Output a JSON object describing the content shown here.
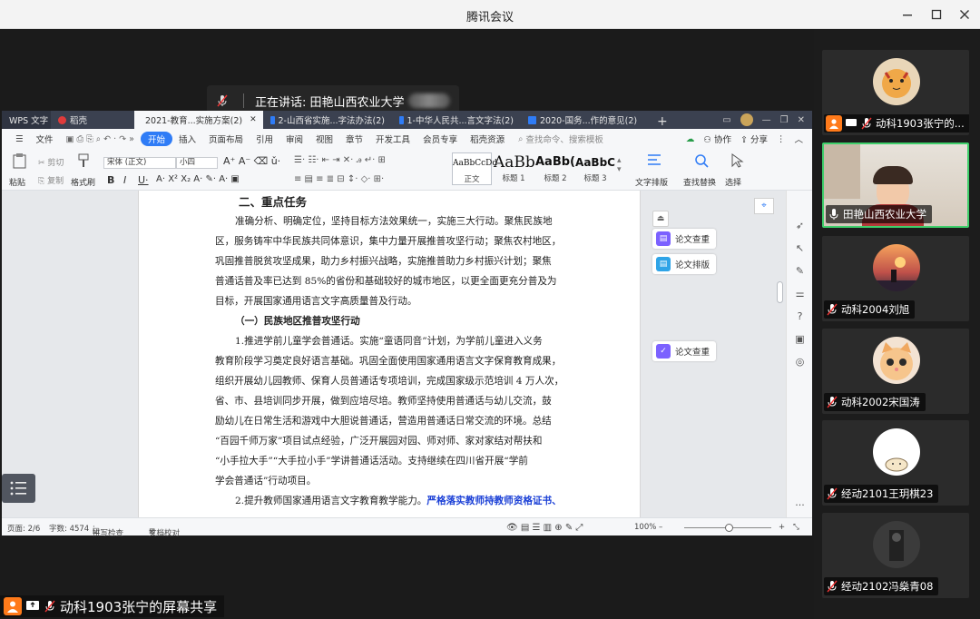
{
  "window": {
    "title": "腾讯会议"
  },
  "speaking": {
    "label": "正在讲话: 田艳山西农业大学"
  },
  "share_label": "动科1903张宁的屏幕共享",
  "wps": {
    "tabs": [
      {
        "label": "WPS 文字",
        "color": "#3b4150"
      },
      {
        "label": "稻壳",
        "color": "#e03b3b"
      },
      {
        "label": "2021-教育...实施方案(2)",
        "color": "#2f7cf6"
      },
      {
        "label": "2-山西省实施...字法办法(2)",
        "color": "#2f7cf6"
      },
      {
        "label": "1-中华人民共...言文字法(2)",
        "color": "#2f7cf6"
      },
      {
        "label": "2020-国务...作的意见(2)",
        "color": "#2f7cf6"
      }
    ],
    "menu": {
      "file": "文件",
      "items": [
        "开始",
        "插入",
        "页面布局",
        "引用",
        "审阅",
        "视图",
        "章节",
        "开发工具",
        "会员专享",
        "稻壳资源"
      ],
      "search": "查找命令、搜索模板",
      "collab": "协作",
      "share": "分享"
    },
    "ribbon": {
      "paste": "粘贴",
      "cut": "剪切",
      "copy": "复制",
      "format_painter": "格式刷",
      "font_name": "宋体 (正文)",
      "font_size": "小四",
      "styles": [
        {
          "sample": "AaBbCcDd",
          "label": "正文"
        },
        {
          "sample": "AaBb",
          "label": "标题 1"
        },
        {
          "sample": "AaBb(",
          "label": "标题 2"
        },
        {
          "sample": "AaBbC",
          "label": "标题 3"
        }
      ],
      "text_layout": "文字排版",
      "find_replace": "查找替换",
      "select": "选择"
    },
    "doc": {
      "lines": [
        "二、重点任务",
        "准确分析、明确定位，坚持目标方法效果统一，实施三大行动。聚焦民族地",
        "区，服务铸牢中华民族共同体意识，集中力量开展推普攻坚行动；聚焦农村地区，",
        "巩固推普脱贫攻坚成果，助力乡村振兴战略，实施推普助力乡村振兴计划；聚焦",
        "普通话普及率已达到 85%的省份和基础较好的城市地区，以更全面更充分普及为",
        "目标，开展国家通用语言文字高质量普及行动。",
        "（一）民族地区推普攻坚行动",
        "1.推进学前儿童学会普通话。实施“童语同音”计划，为学前儿童进入义务",
        "教育阶段学习奠定良好语言基础。巩固全面使用国家通用语言文字保育教育成果，",
        "组织开展幼儿园教师、保育人员普通话专项培训，完成国家级示范培训 4 万人次，",
        "省、市、县培训同步开展，做到应培尽培。教师坚持使用普通话与幼儿交流，鼓",
        "励幼儿在日常生活和游戏中大胆说普通话，营造用普通话日常交流的环境。总结",
        "“百园千师万家”项目试点经验，广泛开展园对园、师对师、家对家结对帮扶和",
        "“小手拉大手”“大手拉小手”学讲普通话活动。支持继续在四川省开展“学前",
        "学会普通话”行动项目。",
        "2.提升教师国家通用语言文字教育教学能力。",
        "严格落实教师持教师资格证书、"
      ]
    },
    "side_panel": {
      "check": "论文查重",
      "layout": "论文排版"
    },
    "status": {
      "page": "页面: 2/6",
      "words": "字数: 4574",
      "spell": "拼写检查",
      "proof": "文档校对",
      "zoom": "100%",
      "zoom_level": 0.52
    }
  },
  "participants": [
    {
      "name": "动科1903张宁的...",
      "avatar": "tiger-avatar"
    },
    {
      "name": "田艳山西农业大学",
      "avatar": "camera-video"
    },
    {
      "name": "动科2004刘旭",
      "avatar": "sunset-avatar"
    },
    {
      "name": "动科2002宋国涛",
      "avatar": "kitten-avatar"
    },
    {
      "name": "经动2101王玥棋23",
      "avatar": "cat-avatar"
    },
    {
      "name": "经动2102冯燊青08",
      "avatar": "dark-avatar"
    }
  ],
  "colors": {
    "accent": "#2f7cf6",
    "active_border": "#3fcf6b",
    "share_orange": "#ff7a1a"
  }
}
